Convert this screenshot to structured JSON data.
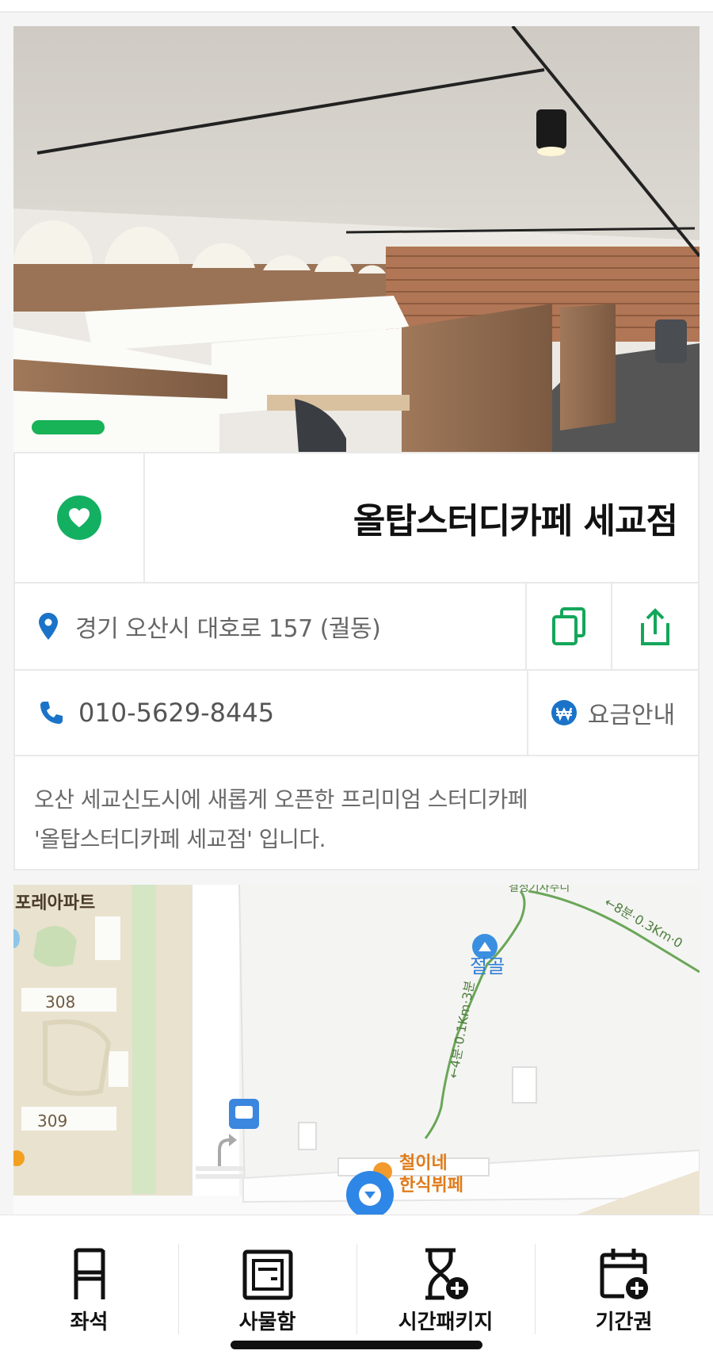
{
  "store": {
    "name": "올탑스터디카페 세교점",
    "address": "경기 오산시 대호로 157 (궐동)",
    "phone": "010-5629-8445",
    "price_label": "요금안내",
    "description_line1": "오산 세교신도시에 새롭게 오픈한 프리미엄 스터디카페",
    "description_line2": "'올탑스터디카페 세교점' 입니다."
  },
  "map": {
    "labels": {
      "apartment": "포레아파트",
      "building_308": "308",
      "building_309": "309",
      "place_jeolgol": "절골",
      "restaurant_line1": "철이네",
      "restaurant_line2": "한식뷔페",
      "route_1": "←4분·0.1Km·3분",
      "route_2": "←8분·0.3Km·0",
      "top_partial": "결정기자주니"
    }
  },
  "nav": {
    "items": [
      {
        "label": "좌석",
        "icon": "chair-icon"
      },
      {
        "label": "사물함",
        "icon": "locker-icon"
      },
      {
        "label": "시간패키지",
        "icon": "hourglass-plus-icon"
      },
      {
        "label": "기간권",
        "icon": "calendar-plus-icon"
      }
    ]
  },
  "colors": {
    "brand_green": "#14b062",
    "pin_blue": "#1a73c8",
    "map_green_route": "#5d9a4a"
  }
}
